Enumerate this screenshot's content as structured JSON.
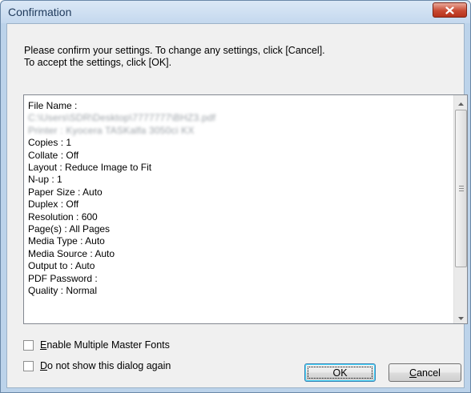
{
  "window": {
    "title": "Confirmation",
    "close_icon": "close-x-icon"
  },
  "message": {
    "line1": "Please confirm your settings. To change any settings, click [Cancel].",
    "line2": "To accept the settings, click [OK]."
  },
  "settings": {
    "file_name_label": "File Name :",
    "file_path_blurred": "C:\\Users\\SDR\\Desktop\\7777777\\BHZ3.pdf",
    "printer_blurred": "Printer : Kyocera TASKalfa 3050ci KX",
    "items": [
      "Copies : 1",
      "Collate : Off",
      "Layout : Reduce Image to Fit",
      "N-up : 1",
      "Paper Size : Auto",
      "Duplex : Off",
      "Resolution : 600",
      "Page(s) : All Pages",
      "Media Type : Auto",
      "Media Source : Auto",
      "Output to : Auto",
      "PDF Password :",
      "Quality : Normal"
    ]
  },
  "options": {
    "enable_mm_fonts": {
      "mnemonic": "E",
      "rest": "nable Multiple Master Fonts",
      "checked": false
    },
    "dont_show_again": {
      "mnemonic": "D",
      "rest": "o not show this dialog again",
      "checked": false
    }
  },
  "buttons": {
    "ok_label": "OK",
    "cancel_mnemonic": "C",
    "cancel_rest": "ancel"
  }
}
